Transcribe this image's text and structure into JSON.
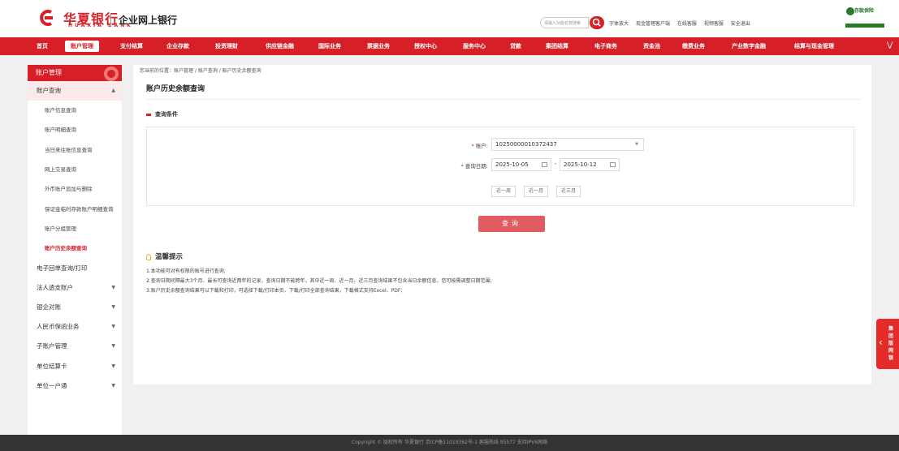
{
  "brand": {
    "name_cn": "华夏银行",
    "name_en": "HUAXIA BANK",
    "subtitle": "企业网上银行",
    "color": "#d71f27"
  },
  "header": {
    "search_placeholder": "请输入功能名称搜索",
    "links": [
      "字体放大",
      "现金管理客户端",
      "在线客服",
      "视频客服",
      "安全退出"
    ],
    "badge_text": "存款保险",
    "icons": [
      "search-icon",
      "font-size-icon",
      "support-icon",
      "video-icon",
      "logout-icon"
    ]
  },
  "nav": {
    "items": [
      "首页",
      "账户管理",
      "支付结算",
      "企业存款",
      "投资理财",
      "供应链金融",
      "国际业务",
      "票据业务",
      "授权中心",
      "服务中心",
      "贷款",
      "集团结算",
      "电子商务",
      "资金池",
      "缴费业务",
      "产业数字金融",
      "结算与现金管理"
    ],
    "active": "账户管理"
  },
  "sidebar": {
    "header": "账户管理",
    "items": [
      {
        "label": "账户查询",
        "expanded": true
      },
      {
        "label": "账户信息查询",
        "sub": true
      },
      {
        "label": "账户明细查询",
        "sub": true
      },
      {
        "label": "当日来往账信息查询",
        "sub": true
      },
      {
        "label": "网上交易查询",
        "sub": true
      },
      {
        "label": "外币账户追加与删除",
        "sub": true
      },
      {
        "label": "保证金临时存款账户明细查询",
        "sub": true
      },
      {
        "label": "账户分组管理",
        "sub": true
      },
      {
        "label": "账户历史余额查询",
        "sub": true,
        "current": true
      },
      {
        "label": "电子回单查询/打印"
      },
      {
        "label": "法人透支账户",
        "arrow": true
      },
      {
        "label": "银企对账",
        "arrow": true
      },
      {
        "label": "人民币保函业务",
        "arrow": true
      },
      {
        "label": "子账户管理",
        "arrow": true
      },
      {
        "label": "单位结算卡",
        "arrow": true
      },
      {
        "label": "单位一户通",
        "arrow": true
      }
    ]
  },
  "main": {
    "breadcrumb": "您当前的位置：账户管理 / 账户查询 / 账户历史余额查询",
    "title": "账户历史余额查询",
    "section_title": "查询条件",
    "account_label": "账户:",
    "account_value": "10250000010372437",
    "date_label": "查询日期:",
    "date_from": "2025-10-05",
    "date_to": "2025-10-12",
    "date_sep": "-",
    "quick_ranges": [
      "近一周",
      "近一月",
      "近三月"
    ],
    "submit_label": "查询",
    "tips_title": "温馨提示",
    "tips": [
      "1.本功能可对有权限的账号进行查询;",
      "2.查询日期间隔最大3个月、最长可查询近两年的记录，查询日期不能跨年，其中近一周、近一月、近三月查询结果不包含当日余额信息，您可按需调整日期范围;",
      "3.账户历史余额查询结果可以下载和打印，可选择下载/打印本页、下载/打印全部查询结果，下载格式支持Excel、PDF;"
    ]
  },
  "float_tab": {
    "text": "集团版网银"
  },
  "footer": {
    "text": "Copyright © 版权所有 华夏银行 京ICP备11019362号-1 客服热线 95577 支持IPV6网络"
  }
}
